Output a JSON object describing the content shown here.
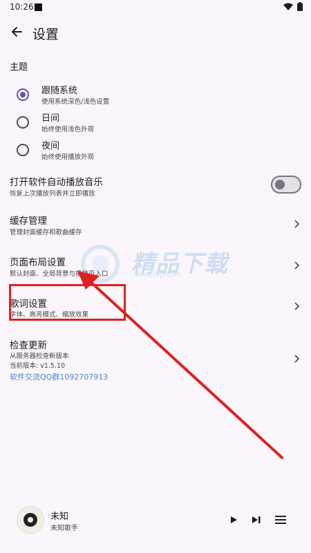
{
  "status_bar": {
    "time": "10:26"
  },
  "app_bar": {
    "title": "设置"
  },
  "theme": {
    "section_title": "主题",
    "options": [
      {
        "label": "跟随系统",
        "description": "使用系统深色/浅色设置",
        "checked": true
      },
      {
        "label": "日间",
        "description": "始终使用浅色外观",
        "checked": false
      },
      {
        "label": "夜间",
        "description": "始终使用播放外观",
        "checked": false
      }
    ]
  },
  "settings": {
    "autoplay": {
      "title": "打开软件自动播放音乐",
      "description": "恢复上次播放列表并立即播放",
      "enabled": false
    },
    "cache": {
      "title": "缓存管理",
      "description": "管理封面缓存和歌曲缓存"
    },
    "layout": {
      "title": "页面布局设置",
      "description": "默认封面、全局背景与播放页入口"
    },
    "lyrics": {
      "title": "歌词设置",
      "description": "字体、高亮模式、缩放效果"
    },
    "update": {
      "title": "检查更新",
      "description": "从服务器检查新版本",
      "version": "当前版本: v1.5.10",
      "group_link": "软件交流QQ群1092707913"
    }
  },
  "watermark": {
    "text": "精品下载",
    "url": "www.j9p.com"
  },
  "player": {
    "title": "未知",
    "artist": "未知歌手"
  },
  "colors": {
    "accent": "#6750a4",
    "annotation": "#e02020",
    "link": "#4a88c7",
    "background": "#fbf6fb"
  }
}
